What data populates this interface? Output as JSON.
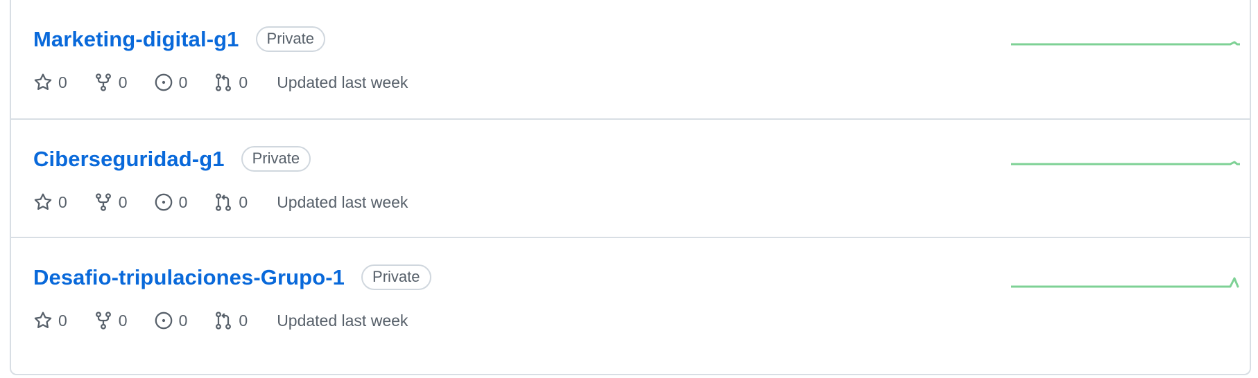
{
  "colors": {
    "link": "#0969da",
    "spark": "#7ed195",
    "border": "#d8dee4",
    "muted": "#57606a"
  },
  "repos": [
    {
      "name": "Marketing-digital-g1",
      "visibility": "Private",
      "stars": "0",
      "forks": "0",
      "issues": "0",
      "pulls": "0",
      "updated": "Updated last week",
      "activity": "flat-small-bump"
    },
    {
      "name": "Ciberseguridad-g1",
      "visibility": "Private",
      "stars": "0",
      "forks": "0",
      "issues": "0",
      "pulls": "0",
      "updated": "Updated last week",
      "activity": "flat-small-bump"
    },
    {
      "name": "Desafio-tripulaciones-Grupo-1",
      "visibility": "Private",
      "stars": "0",
      "forks": "0",
      "issues": "0",
      "pulls": "0",
      "updated": "Updated last week",
      "activity": "flat-spike"
    }
  ],
  "icons": {
    "star": "star-icon",
    "fork": "repo-forked-icon",
    "issue": "issue-opened-icon",
    "pull": "git-pull-request-icon"
  }
}
